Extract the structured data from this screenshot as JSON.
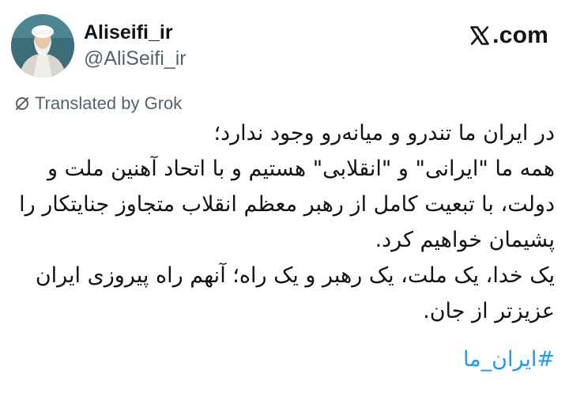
{
  "author": {
    "display_name": "Aliseifi_ir",
    "handle": "@AliSeifi_ir",
    "avatar_icon": "avatar"
  },
  "brand": {
    "label": ".com",
    "icon": "x-logo-icon"
  },
  "translation": {
    "label": "Translated by Grok",
    "icon": "grok-icon"
  },
  "tweet": {
    "lines": [
      "در ایران ما تندرو و میانه‌رو وجود ندارد؛",
      "همه ما \"ایرانی\" و \"انقلابی\" هستیم و با اتحاد آهنین ملت و",
      "دولت، با تبعیت کامل از رهبر معظم انقلاب متجاوز جنایتکار را",
      "پشیمان خواهیم کرد.",
      "یک خدا، یک ملت، یک رهبر و یک راه؛ آنهم راه پیروزی ایران",
      "عزیزتر از جان."
    ],
    "hashtag": "#ایران_ما"
  },
  "colors": {
    "text": "#0f1419",
    "muted": "#536471",
    "link": "#1d9bf0"
  }
}
